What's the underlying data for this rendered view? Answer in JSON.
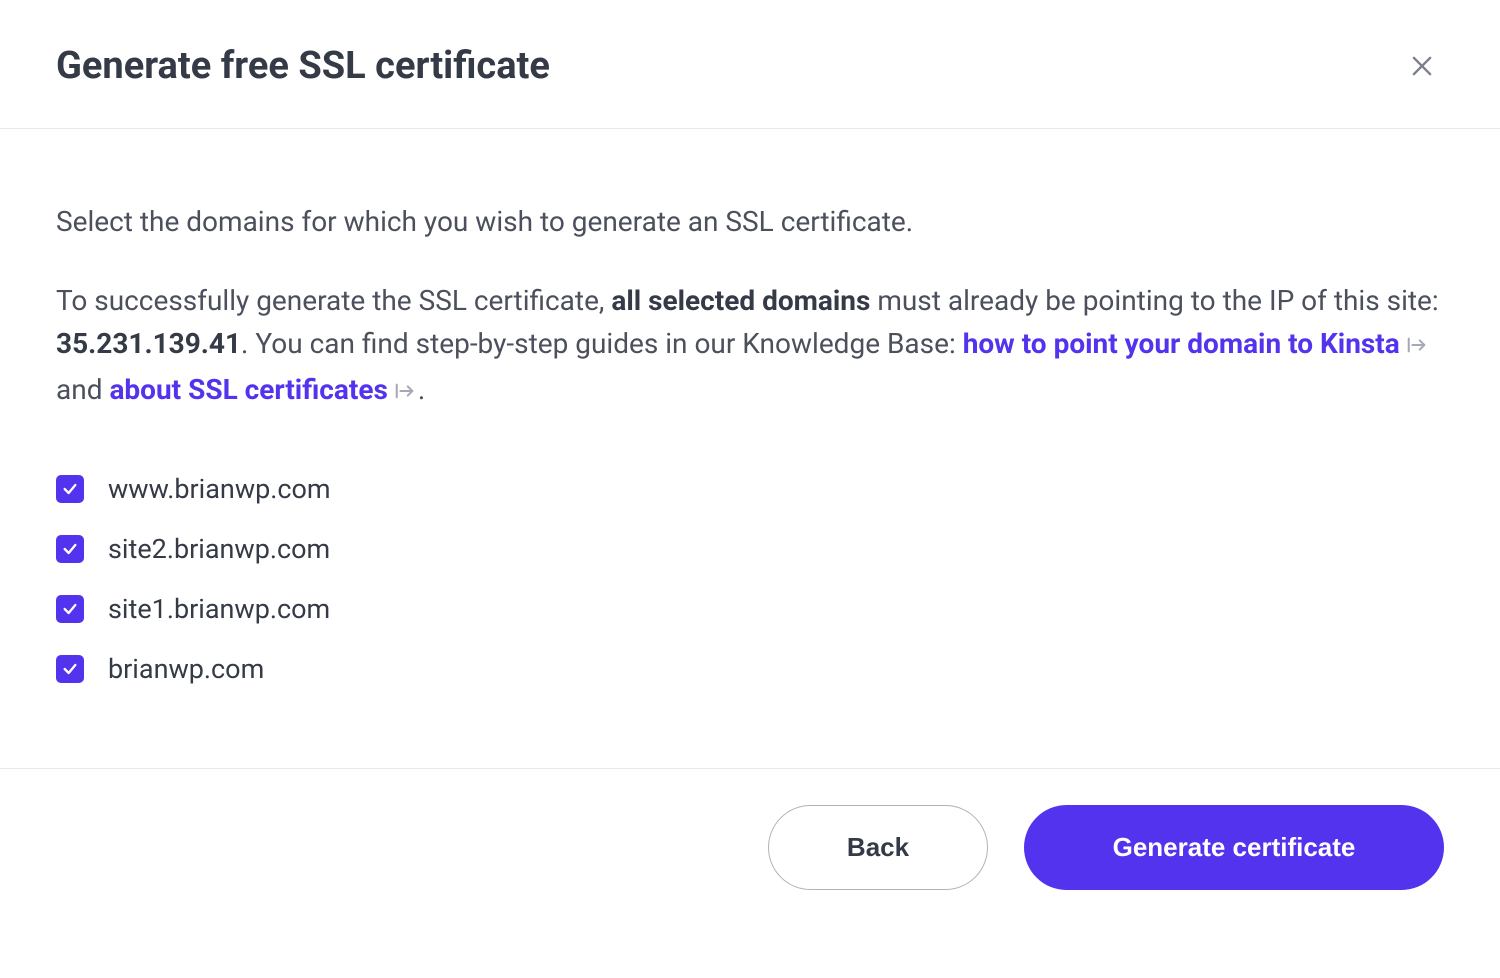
{
  "header": {
    "title": "Generate free SSL certificate"
  },
  "body": {
    "instruction": "Select the domains for which you wish to generate an SSL certificate.",
    "detail_prefix": "To successfully generate the SSL certificate, ",
    "detail_bold1": "all selected domains",
    "detail_mid1": " must already be pointing to the IP of this site: ",
    "detail_ip": "35.231.139.41",
    "detail_mid2": ". You can find step-by-step guides in our Knowledge Base: ",
    "link1": "how to point your domain to Kinsta",
    "conjunction": " and ",
    "link2": "about SSL certificates",
    "detail_end": "."
  },
  "domains": [
    {
      "label": "www.brianwp.com",
      "checked": true
    },
    {
      "label": "site2.brianwp.com",
      "checked": true
    },
    {
      "label": "site1.brianwp.com",
      "checked": true
    },
    {
      "label": "brianwp.com",
      "checked": true
    }
  ],
  "footer": {
    "back_label": "Back",
    "generate_label": "Generate certificate"
  },
  "colors": {
    "accent": "#5333ed",
    "text": "#353a47",
    "muted": "#4b505c",
    "border": "#e9eaec"
  }
}
